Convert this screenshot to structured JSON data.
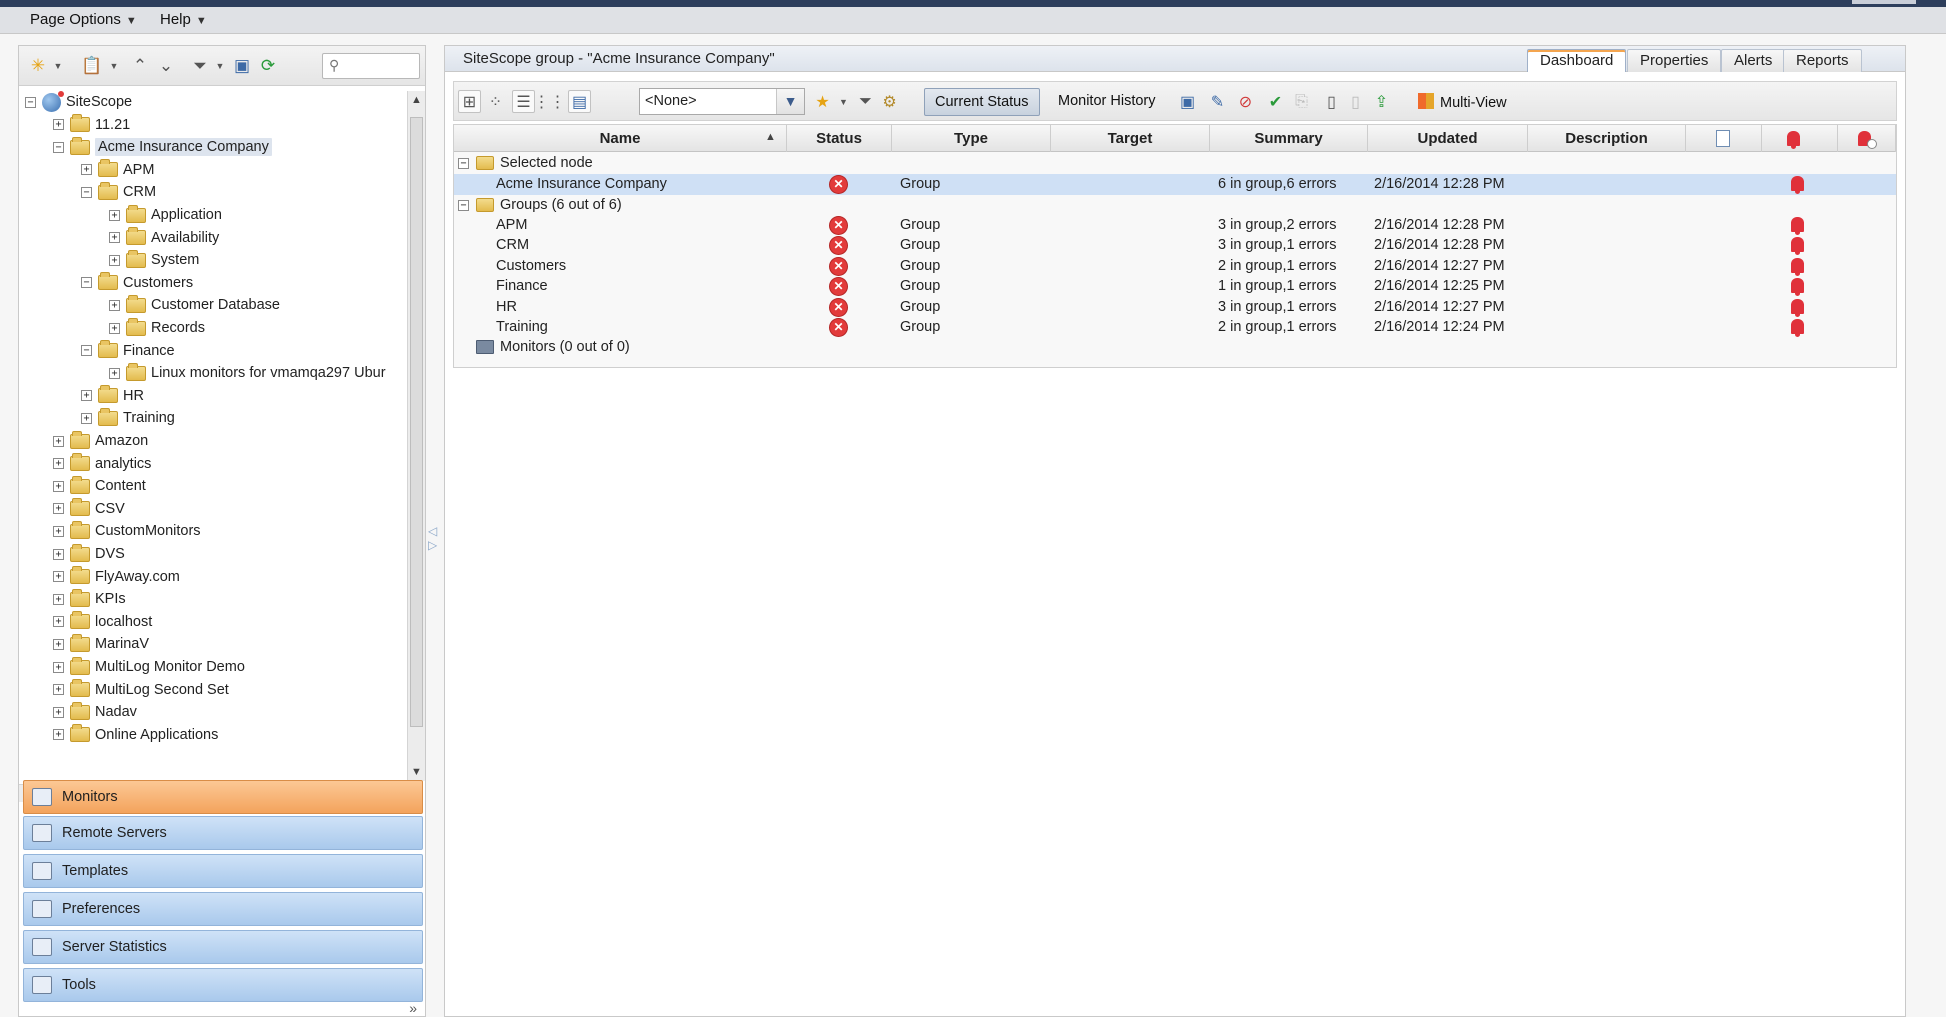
{
  "menu": {
    "page_options": "Page Options",
    "help": "Help"
  },
  "left": {
    "search_placeholder": "",
    "tree": [
      {
        "label": "SiteScope",
        "depth": 0,
        "exp": "−",
        "icon": "globe"
      },
      {
        "label": "11.21",
        "depth": 1,
        "exp": "+"
      },
      {
        "label": "Acme Insurance Company",
        "depth": 1,
        "exp": "−",
        "selected": true
      },
      {
        "label": "APM",
        "depth": 2,
        "exp": "+"
      },
      {
        "label": "CRM",
        "depth": 2,
        "exp": "−"
      },
      {
        "label": "Application",
        "depth": 3,
        "exp": "+"
      },
      {
        "label": "Availability",
        "depth": 3,
        "exp": "+"
      },
      {
        "label": "System",
        "depth": 3,
        "exp": "+"
      },
      {
        "label": "Customers",
        "depth": 2,
        "exp": "−"
      },
      {
        "label": "Customer Database",
        "depth": 3,
        "exp": "+"
      },
      {
        "label": "Records",
        "depth": 3,
        "exp": "+"
      },
      {
        "label": "Finance",
        "depth": 2,
        "exp": "−"
      },
      {
        "label": "Linux monitors for vmamqa297 Ubur",
        "depth": 3,
        "exp": "+"
      },
      {
        "label": "HR",
        "depth": 2,
        "exp": "+"
      },
      {
        "label": "Training",
        "depth": 2,
        "exp": "+"
      },
      {
        "label": "Amazon",
        "depth": 1,
        "exp": "+"
      },
      {
        "label": "analytics",
        "depth": 1,
        "exp": "+"
      },
      {
        "label": "Content",
        "depth": 1,
        "exp": "+"
      },
      {
        "label": "CSV",
        "depth": 1,
        "exp": "+"
      },
      {
        "label": "CustomMonitors",
        "depth": 1,
        "exp": "+"
      },
      {
        "label": "DVS",
        "depth": 1,
        "exp": "+"
      },
      {
        "label": "FlyAway.com",
        "depth": 1,
        "exp": "+"
      },
      {
        "label": "KPIs",
        "depth": 1,
        "exp": "+"
      },
      {
        "label": "localhost",
        "depth": 1,
        "exp": "+"
      },
      {
        "label": "MarinaV",
        "depth": 1,
        "exp": "+"
      },
      {
        "label": "MultiLog Monitor Demo",
        "depth": 1,
        "exp": "+"
      },
      {
        "label": "MultiLog Second Set",
        "depth": 1,
        "exp": "+"
      },
      {
        "label": "Nadav",
        "depth": 1,
        "exp": "+"
      },
      {
        "label": "Online Applications",
        "depth": 1,
        "exp": "+"
      }
    ],
    "nav": [
      {
        "label": "Monitors",
        "active": true,
        "name": "monitors"
      },
      {
        "label": "Remote Servers",
        "active": false,
        "name": "remote-servers"
      },
      {
        "label": "Templates",
        "active": false,
        "name": "templates"
      },
      {
        "label": "Preferences",
        "active": false,
        "name": "preferences"
      },
      {
        "label": "Server Statistics",
        "active": false,
        "name": "server-statistics"
      },
      {
        "label": "Tools",
        "active": false,
        "name": "tools"
      }
    ],
    "more": "»"
  },
  "right": {
    "title": "SiteScope group - \"Acme Insurance Company\"",
    "tabs": [
      "Dashboard",
      "Properties",
      "Alerts",
      "Reports"
    ],
    "active_tab": "Dashboard",
    "filter_value": "<None>",
    "current_status": "Current Status",
    "monitor_history": "Monitor History",
    "multi_view": "Multi-View",
    "columns": [
      "Name",
      "Status",
      "Type",
      "Target",
      "Summary",
      "Updated",
      "Description"
    ],
    "selected_node_label": "Selected node",
    "groups_label": "Groups (6 out of 6)",
    "monitors_label": "Monitors (0 out of 0)",
    "selected_row": {
      "name": "Acme Insurance Company",
      "type": "Group",
      "summary": "6 in group,6 errors",
      "updated": "2/16/2014 12:28 PM"
    },
    "group_rows": [
      {
        "name": "APM",
        "type": "Group",
        "summary": "3 in group,2 errors",
        "updated": "2/16/2014 12:28 PM"
      },
      {
        "name": "CRM",
        "type": "Group",
        "summary": "3 in group,1 errors",
        "updated": "2/16/2014 12:28 PM"
      },
      {
        "name": "Customers",
        "type": "Group",
        "summary": "2 in group,1 errors",
        "updated": "2/16/2014 12:27 PM"
      },
      {
        "name": "Finance",
        "type": "Group",
        "summary": "1 in group,1 errors",
        "updated": "2/16/2014 12:25 PM"
      },
      {
        "name": "HR",
        "type": "Group",
        "summary": "3 in group,1 errors",
        "updated": "2/16/2014 12:27 PM"
      },
      {
        "name": "Training",
        "type": "Group",
        "summary": "2 in group,1 errors",
        "updated": "2/16/2014 12:24 PM"
      }
    ],
    "colors": {
      "error": "#e23b3b",
      "selected_row": "#cfe0f5",
      "active_nav": "#f3a35c"
    }
  }
}
